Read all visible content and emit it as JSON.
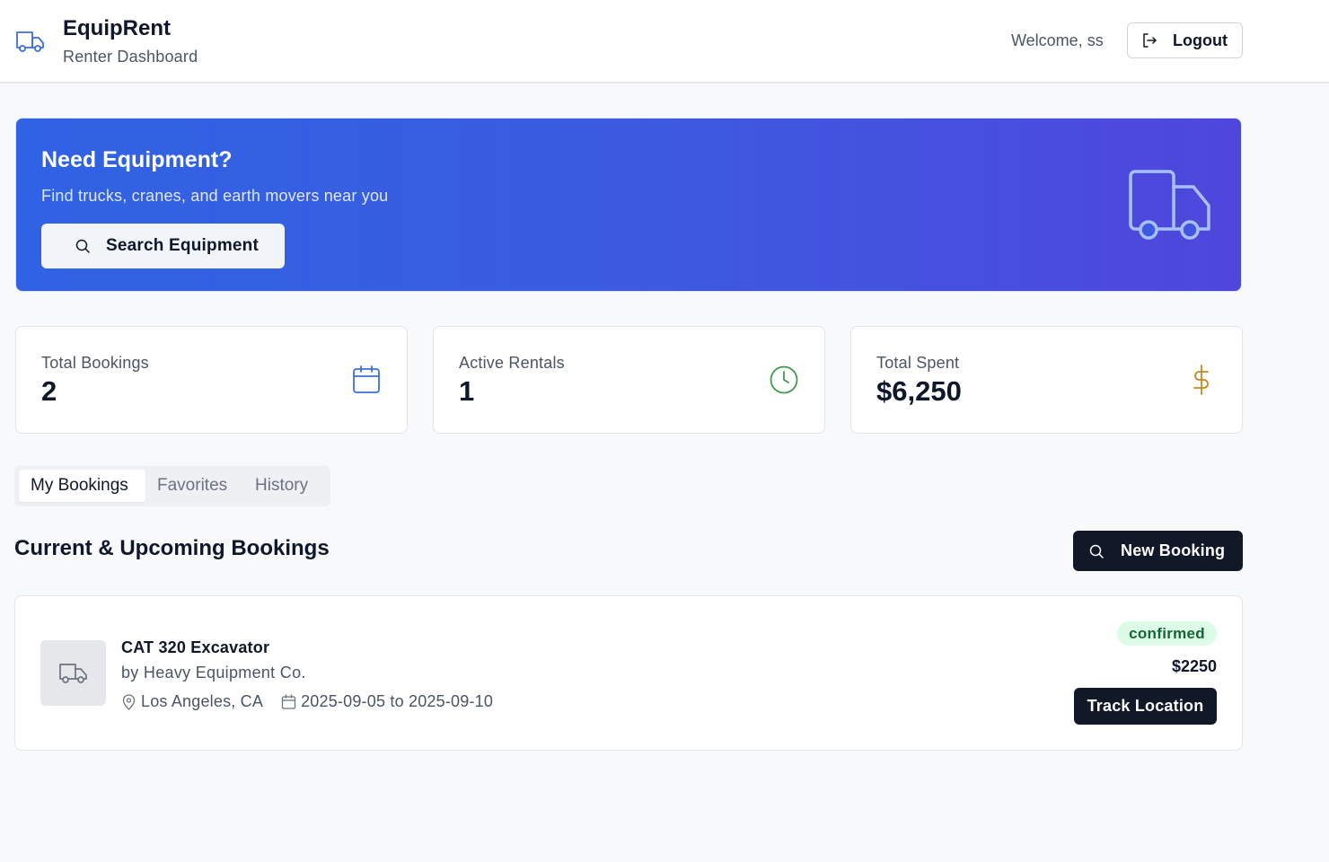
{
  "header": {
    "title": "EquipRent",
    "subtitle": "Renter Dashboard",
    "welcome": "Welcome, ss",
    "logout_label": "Logout",
    "logo_icon": "truck-icon"
  },
  "hero": {
    "title": "Need Equipment?",
    "subtitle": "Find trucks, cranes, and earth movers near you",
    "search_label": "Search Equipment",
    "icon": "truck-icon"
  },
  "stats": [
    {
      "label": "Total Bookings",
      "value": "2",
      "icon": "calendar-icon",
      "color": "#3b6fd8"
    },
    {
      "label": "Active Rentals",
      "value": "1",
      "icon": "clock-icon",
      "color": "#3f9a4b"
    },
    {
      "label": "Total Spent",
      "value": "$6,250",
      "icon": "dollar-icon",
      "color": "#c28a1e"
    }
  ],
  "tabs": [
    {
      "label": "My Bookings",
      "active": true
    },
    {
      "label": "Favorites",
      "active": false
    },
    {
      "label": "History",
      "active": false
    }
  ],
  "section": {
    "title": "Current & Upcoming Bookings",
    "new_booking_label": "New Booking"
  },
  "bookings": [
    {
      "name": "CAT 320 Excavator",
      "owner": "by Heavy Equipment Co.",
      "location": "Los Angeles, CA",
      "dates": "2025-09-05 to 2025-09-10",
      "status": "confirmed",
      "price": "$2250",
      "track_label": "Track Location"
    }
  ],
  "colors": {
    "accent": "#3c5be0",
    "hero_gradient_start": "#2f63e3",
    "hero_gradient_end": "#4f46dc",
    "dark_button": "#111827",
    "status_confirmed_bg": "#dcfce7",
    "status_confirmed_text": "#166534"
  }
}
